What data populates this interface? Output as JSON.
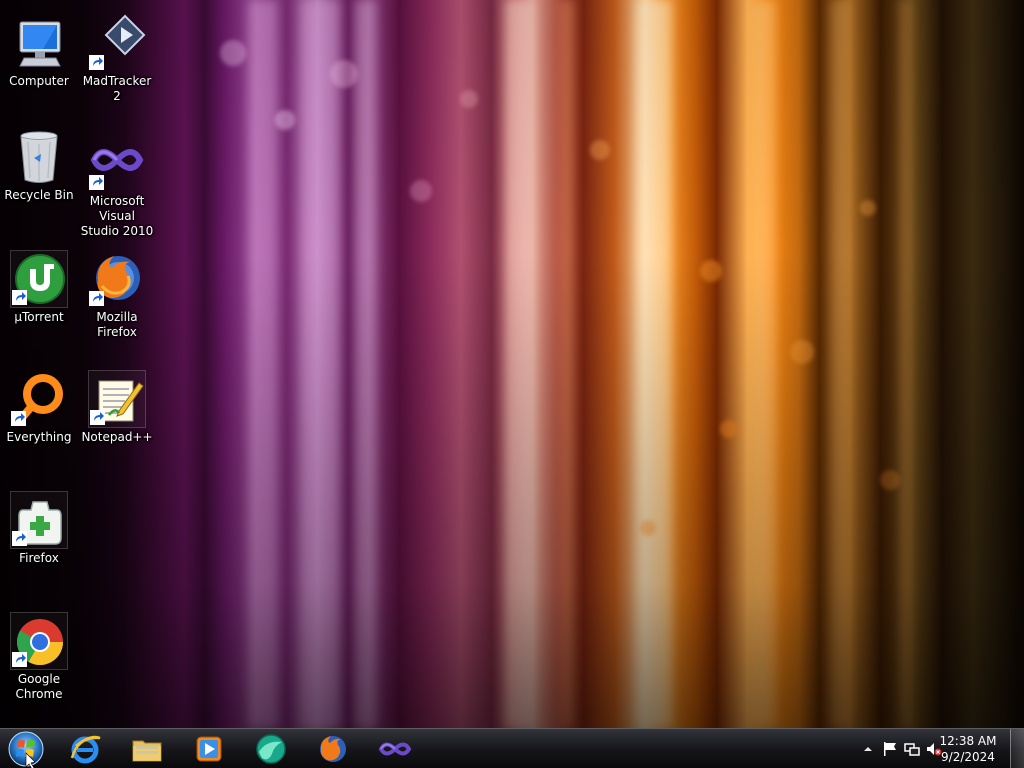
{
  "desktop": {
    "icons": [
      {
        "label": "Computer",
        "icon": "computer-icon",
        "shortcut": false
      },
      {
        "label": "Recycle Bin",
        "icon": "recycle-bin-icon",
        "shortcut": false
      },
      {
        "label": "µTorrent",
        "icon": "utorrent-icon",
        "shortcut": true
      },
      {
        "label": "Everything",
        "icon": "everything-search-icon",
        "shortcut": true
      },
      {
        "label": "Firefox",
        "icon": "firefox-portable-icon",
        "shortcut": true
      },
      {
        "label": "Google Chrome",
        "icon": "chrome-icon",
        "shortcut": true
      },
      {
        "label": "MadTracker 2",
        "icon": "madtracker-icon",
        "shortcut": true
      },
      {
        "label": "Microsoft Visual Studio 2010",
        "icon": "visual-studio-icon",
        "shortcut": true
      },
      {
        "label": "Mozilla Firefox",
        "icon": "firefox-icon",
        "shortcut": true
      },
      {
        "label": "Notepad++",
        "icon": "notepad-plus-plus-icon",
        "shortcut": true
      }
    ]
  },
  "taskbar": {
    "start": {
      "icon": "windows-start-orb-icon"
    },
    "pinned": [
      {
        "name": "Internet Explorer",
        "icon": "internet-explorer-icon"
      },
      {
        "name": "Windows Explorer",
        "icon": "folder-icon"
      },
      {
        "name": "Windows Media Player",
        "icon": "media-player-icon"
      },
      {
        "name": "Browser",
        "icon": "teal-globe-icon"
      },
      {
        "name": "Mozilla Firefox",
        "icon": "firefox-icon"
      },
      {
        "name": "Visual Studio",
        "icon": "visual-studio-icon"
      }
    ],
    "tray": {
      "icons": [
        "show-hidden-icons-icon",
        "action-center-flag-icon",
        "network-icon",
        "volume-muted-icon"
      ],
      "time": "12:38 AM",
      "date": "9/2/2024"
    }
  },
  "colors": {
    "taskbar": "#1a1a1f",
    "label_text": "#ffffff",
    "wallpaper_purple": "#8e3e80",
    "wallpaper_orange": "#ff8a10"
  }
}
